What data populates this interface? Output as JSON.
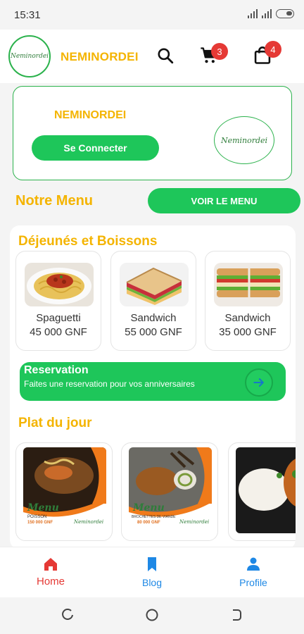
{
  "status": {
    "time": "15:31"
  },
  "header": {
    "brand": "NEMINORDEI",
    "logo_text": "Neminordei",
    "cart_count": "3",
    "bag_count": "4",
    "icons": [
      "search-icon",
      "cart-icon",
      "shopping-bag-icon"
    ]
  },
  "hero": {
    "brand": "NEMINORDEI",
    "connect_label": "Se Connecter",
    "logo_text": "Neminordei"
  },
  "menu": {
    "title": "Notre Menu",
    "see_menu_label": "VOIR LE MENU"
  },
  "lunch": {
    "title": "Déjeunés et Boissons",
    "items": [
      {
        "name": "Spaguetti",
        "price": "45 000 GNF"
      },
      {
        "name": "Sandwich",
        "price": "55 000 GNF"
      },
      {
        "name": "Sandwich",
        "price": "35 000 GNF"
      }
    ]
  },
  "reservation": {
    "title": "Reservation",
    "subtitle": "Faites une reservation pour vos anniversaires"
  },
  "daily": {
    "title": "Plat du jour",
    "items": [
      {
        "menu": "Menu",
        "dish": "POISSON",
        "price": "150 000 GNF",
        "brand": "Neminordei"
      },
      {
        "menu": "Menu",
        "dish": "BROCHETTES DE VIANDE",
        "price": "80 000 GNF",
        "brand": "Neminordei"
      }
    ]
  },
  "nav": {
    "items": [
      {
        "label": "Home",
        "icon": "home-icon",
        "active": true
      },
      {
        "label": "Blog",
        "icon": "bookmark-icon",
        "active": false
      },
      {
        "label": "Profile",
        "icon": "person-icon",
        "active": false
      }
    ]
  },
  "colors": {
    "accent_green": "#1ec65a",
    "brand_yellow": "#f4b400",
    "active_red": "#e53935",
    "nav_blue": "#1e88e5"
  }
}
